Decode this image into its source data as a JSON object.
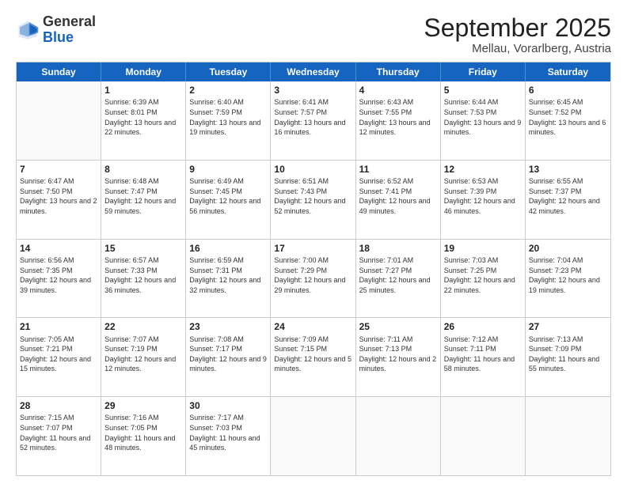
{
  "logo": {
    "general": "General",
    "blue": "Blue"
  },
  "header": {
    "month": "September 2025",
    "location": "Mellau, Vorarlberg, Austria"
  },
  "weekdays": [
    "Sunday",
    "Monday",
    "Tuesday",
    "Wednesday",
    "Thursday",
    "Friday",
    "Saturday"
  ],
  "rows": [
    [
      {
        "day": "",
        "empty": true
      },
      {
        "day": "1",
        "sunrise": "Sunrise: 6:39 AM",
        "sunset": "Sunset: 8:01 PM",
        "daylight": "Daylight: 13 hours and 22 minutes."
      },
      {
        "day": "2",
        "sunrise": "Sunrise: 6:40 AM",
        "sunset": "Sunset: 7:59 PM",
        "daylight": "Daylight: 13 hours and 19 minutes."
      },
      {
        "day": "3",
        "sunrise": "Sunrise: 6:41 AM",
        "sunset": "Sunset: 7:57 PM",
        "daylight": "Daylight: 13 hours and 16 minutes."
      },
      {
        "day": "4",
        "sunrise": "Sunrise: 6:43 AM",
        "sunset": "Sunset: 7:55 PM",
        "daylight": "Daylight: 13 hours and 12 minutes."
      },
      {
        "day": "5",
        "sunrise": "Sunrise: 6:44 AM",
        "sunset": "Sunset: 7:53 PM",
        "daylight": "Daylight: 13 hours and 9 minutes."
      },
      {
        "day": "6",
        "sunrise": "Sunrise: 6:45 AM",
        "sunset": "Sunset: 7:52 PM",
        "daylight": "Daylight: 13 hours and 6 minutes."
      }
    ],
    [
      {
        "day": "7",
        "sunrise": "Sunrise: 6:47 AM",
        "sunset": "Sunset: 7:50 PM",
        "daylight": "Daylight: 13 hours and 2 minutes."
      },
      {
        "day": "8",
        "sunrise": "Sunrise: 6:48 AM",
        "sunset": "Sunset: 7:47 PM",
        "daylight": "Daylight: 12 hours and 59 minutes."
      },
      {
        "day": "9",
        "sunrise": "Sunrise: 6:49 AM",
        "sunset": "Sunset: 7:45 PM",
        "daylight": "Daylight: 12 hours and 56 minutes."
      },
      {
        "day": "10",
        "sunrise": "Sunrise: 6:51 AM",
        "sunset": "Sunset: 7:43 PM",
        "daylight": "Daylight: 12 hours and 52 minutes."
      },
      {
        "day": "11",
        "sunrise": "Sunrise: 6:52 AM",
        "sunset": "Sunset: 7:41 PM",
        "daylight": "Daylight: 12 hours and 49 minutes."
      },
      {
        "day": "12",
        "sunrise": "Sunrise: 6:53 AM",
        "sunset": "Sunset: 7:39 PM",
        "daylight": "Daylight: 12 hours and 46 minutes."
      },
      {
        "day": "13",
        "sunrise": "Sunrise: 6:55 AM",
        "sunset": "Sunset: 7:37 PM",
        "daylight": "Daylight: 12 hours and 42 minutes."
      }
    ],
    [
      {
        "day": "14",
        "sunrise": "Sunrise: 6:56 AM",
        "sunset": "Sunset: 7:35 PM",
        "daylight": "Daylight: 12 hours and 39 minutes."
      },
      {
        "day": "15",
        "sunrise": "Sunrise: 6:57 AM",
        "sunset": "Sunset: 7:33 PM",
        "daylight": "Daylight: 12 hours and 36 minutes."
      },
      {
        "day": "16",
        "sunrise": "Sunrise: 6:59 AM",
        "sunset": "Sunset: 7:31 PM",
        "daylight": "Daylight: 12 hours and 32 minutes."
      },
      {
        "day": "17",
        "sunrise": "Sunrise: 7:00 AM",
        "sunset": "Sunset: 7:29 PM",
        "daylight": "Daylight: 12 hours and 29 minutes."
      },
      {
        "day": "18",
        "sunrise": "Sunrise: 7:01 AM",
        "sunset": "Sunset: 7:27 PM",
        "daylight": "Daylight: 12 hours and 25 minutes."
      },
      {
        "day": "19",
        "sunrise": "Sunrise: 7:03 AM",
        "sunset": "Sunset: 7:25 PM",
        "daylight": "Daylight: 12 hours and 22 minutes."
      },
      {
        "day": "20",
        "sunrise": "Sunrise: 7:04 AM",
        "sunset": "Sunset: 7:23 PM",
        "daylight": "Daylight: 12 hours and 19 minutes."
      }
    ],
    [
      {
        "day": "21",
        "sunrise": "Sunrise: 7:05 AM",
        "sunset": "Sunset: 7:21 PM",
        "daylight": "Daylight: 12 hours and 15 minutes."
      },
      {
        "day": "22",
        "sunrise": "Sunrise: 7:07 AM",
        "sunset": "Sunset: 7:19 PM",
        "daylight": "Daylight: 12 hours and 12 minutes."
      },
      {
        "day": "23",
        "sunrise": "Sunrise: 7:08 AM",
        "sunset": "Sunset: 7:17 PM",
        "daylight": "Daylight: 12 hours and 9 minutes."
      },
      {
        "day": "24",
        "sunrise": "Sunrise: 7:09 AM",
        "sunset": "Sunset: 7:15 PM",
        "daylight": "Daylight: 12 hours and 5 minutes."
      },
      {
        "day": "25",
        "sunrise": "Sunrise: 7:11 AM",
        "sunset": "Sunset: 7:13 PM",
        "daylight": "Daylight: 12 hours and 2 minutes."
      },
      {
        "day": "26",
        "sunrise": "Sunrise: 7:12 AM",
        "sunset": "Sunset: 7:11 PM",
        "daylight": "Daylight: 11 hours and 58 minutes."
      },
      {
        "day": "27",
        "sunrise": "Sunrise: 7:13 AM",
        "sunset": "Sunset: 7:09 PM",
        "daylight": "Daylight: 11 hours and 55 minutes."
      }
    ],
    [
      {
        "day": "28",
        "sunrise": "Sunrise: 7:15 AM",
        "sunset": "Sunset: 7:07 PM",
        "daylight": "Daylight: 11 hours and 52 minutes."
      },
      {
        "day": "29",
        "sunrise": "Sunrise: 7:16 AM",
        "sunset": "Sunset: 7:05 PM",
        "daylight": "Daylight: 11 hours and 48 minutes."
      },
      {
        "day": "30",
        "sunrise": "Sunrise: 7:17 AM",
        "sunset": "Sunset: 7:03 PM",
        "daylight": "Daylight: 11 hours and 45 minutes."
      },
      {
        "day": "",
        "empty": true
      },
      {
        "day": "",
        "empty": true
      },
      {
        "day": "",
        "empty": true
      },
      {
        "day": "",
        "empty": true
      }
    ]
  ]
}
